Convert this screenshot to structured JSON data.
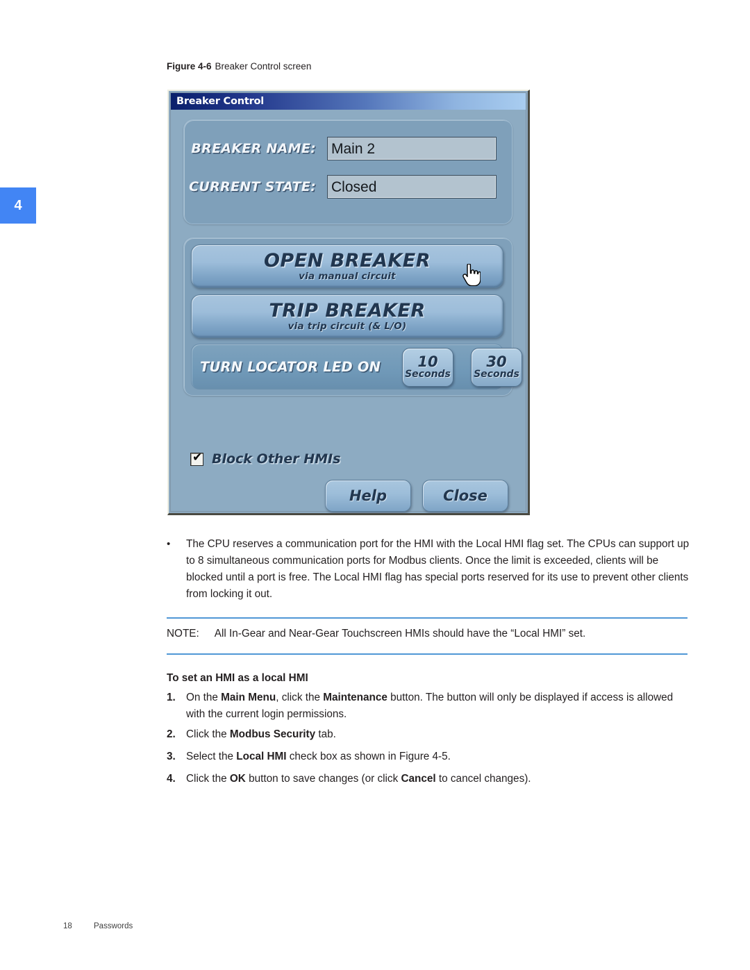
{
  "chapter_tab": {
    "number": "4",
    "color": "#4285f4"
  },
  "figure": {
    "caption_number": "Figure 4-6",
    "caption_text": "Breaker Control screen"
  },
  "screenshot": {
    "title_bar": {
      "title": "Breaker Control"
    },
    "info": {
      "breaker_name_label": "BREAKER NAME:",
      "breaker_name_value": "Main 2",
      "current_state_label": "CURRENT STATE:",
      "current_state_value": "Closed"
    },
    "actions": {
      "open_breaker": {
        "title": "OPEN BREAKER",
        "subtitle": "via manual circuit"
      },
      "trip_breaker": {
        "title": "TRIP BREAKER",
        "subtitle": "via trip circuit (& L/O)"
      },
      "locator_label": "TURN LOCATOR LED ON",
      "locator_buttons": [
        {
          "number": "10",
          "unit": "Seconds"
        },
        {
          "number": "30",
          "unit": "Seconds"
        }
      ]
    },
    "checkbox": {
      "label": "Block Other HMIs",
      "checked_glyph": "✔"
    },
    "footer_buttons": {
      "help": "Help",
      "close": "Close"
    },
    "cursor": "hand-pointer-cursor"
  },
  "body": {
    "bullet": "The CPU reserves a communication port for the HMI with the Local HMI flag set. The CPUs can support up to 8 simultaneous communication ports for Modbus clients. Once the limit is exceeded, clients will be blocked until a port is free. The Local HMI flag has special ports reserved for its use to prevent other clients from locking it out.",
    "bullet_marker": "•",
    "note_label": "NOTE:",
    "note_text": "All In-Gear and Near-Gear Touchscreen HMIs should have the “Local HMI” set.",
    "subheading": "To set an HMI as a local HMI",
    "steps": [
      {
        "number": "1.",
        "parts": [
          {
            "t": "On the ",
            "b": false
          },
          {
            "t": "Main Menu",
            "b": true
          },
          {
            "t": ", click the ",
            "b": false
          },
          {
            "t": "Maintenance",
            "b": true
          },
          {
            "t": " button. The button will only be displayed if access is allowed with the current login permissions.",
            "b": false
          }
        ]
      },
      {
        "number": "2.",
        "parts": [
          {
            "t": "Click the ",
            "b": false
          },
          {
            "t": "Modbus Security",
            "b": true
          },
          {
            "t": " tab.",
            "b": false
          }
        ]
      },
      {
        "number": "3.",
        "parts": [
          {
            "t": "Select the ",
            "b": false
          },
          {
            "t": "Local HMI",
            "b": true
          },
          {
            "t": " check box as shown in Figure 4-5.",
            "b": false
          }
        ]
      },
      {
        "number": "4.",
        "parts": [
          {
            "t": "Click the ",
            "b": false
          },
          {
            "t": "OK",
            "b": true
          },
          {
            "t": " button to save changes (or click ",
            "b": false
          },
          {
            "t": "Cancel",
            "b": true
          },
          {
            "t": " to cancel changes).",
            "b": false
          }
        ]
      }
    ]
  },
  "footer": {
    "page_number": "18",
    "section": "Passwords"
  }
}
